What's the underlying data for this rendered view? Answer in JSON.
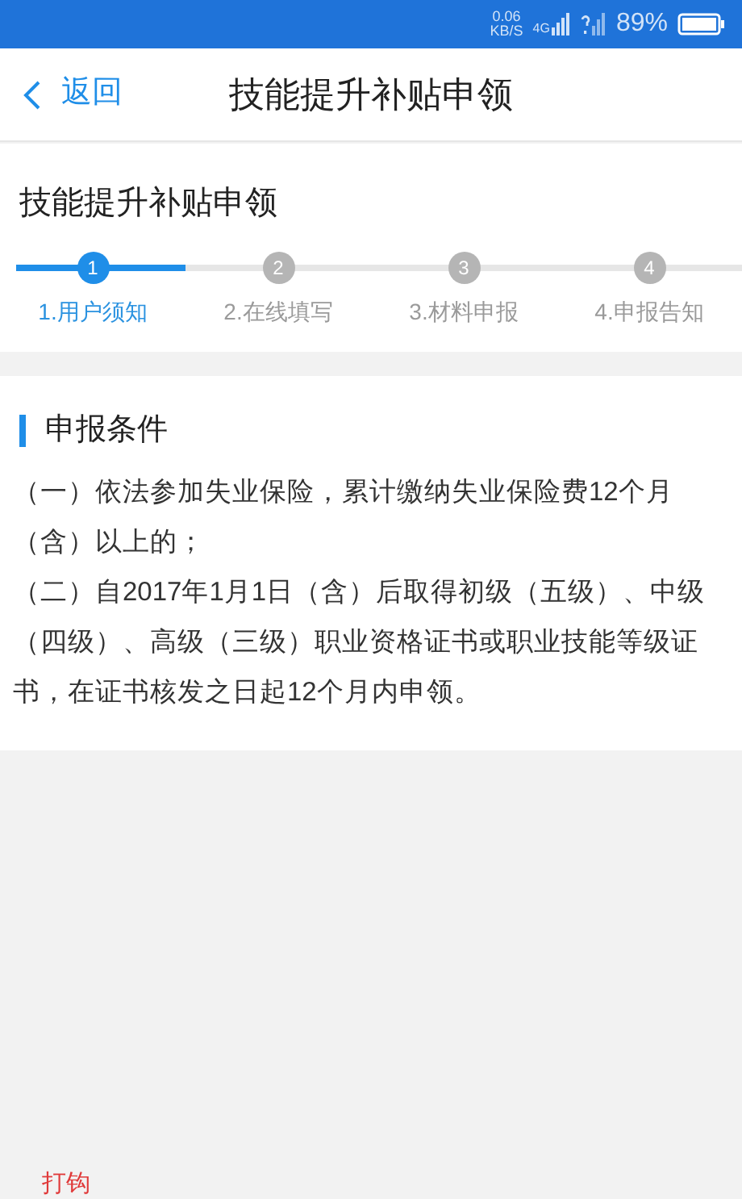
{
  "status_bar": {
    "speed": "0.06",
    "speed_unit": "KB/S",
    "network": "4G",
    "battery": "89%"
  },
  "nav": {
    "back": "返回",
    "title": "技能提升补贴申领"
  },
  "form_title": "技能提升补贴申领",
  "steps": [
    {
      "number": "1",
      "label": "1.用户须知",
      "selected": true
    },
    {
      "number": "2",
      "label": "2.在线填写",
      "selected": false
    },
    {
      "number": "3",
      "label": "3.材料申报",
      "selected": false
    },
    {
      "number": "4",
      "label": "4.申报告知",
      "selected": false
    }
  ],
  "section": {
    "title": "申报条件",
    "paragraphs": [
      "（一）依法参加失业保险，累计缴纳失业保险费12个月（含）以上的；",
      "（二）自2017年1月1日（含）后取得初级（五级）、中级（四级）、高级（三级）职业资格证书或职业技能等级证书，在证书核发之日起12个月内申领。"
    ]
  },
  "footer_note": "打钩"
}
